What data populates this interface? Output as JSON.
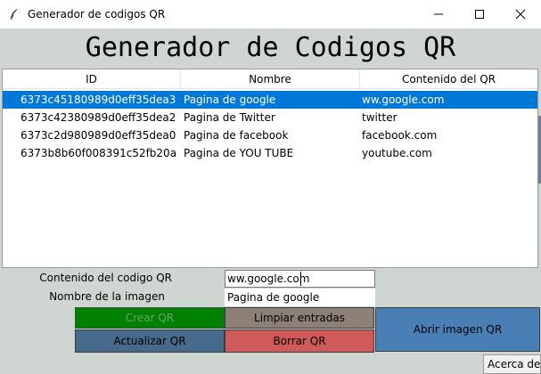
{
  "window": {
    "title": "Generador de codigos QR",
    "icon": "feather-icon",
    "controls": [
      "minimize-icon",
      "maximize-icon",
      "close-icon"
    ]
  },
  "heading": "Generador de Codigos QR",
  "table": {
    "columns": [
      "ID",
      "Nombre",
      "Contenido del QR"
    ],
    "rows": [
      {
        "id": "6373c45180989d0eff35dea3",
        "nombre": "Pagina de google",
        "contenido": "ww.google.com",
        "selected": true
      },
      {
        "id": "6373c42380989d0eff35dea2",
        "nombre": "Pagina de Twitter",
        "contenido": "twitter",
        "selected": false
      },
      {
        "id": "6373c2d980989d0eff35dea0",
        "nombre": "Pagina de facebook",
        "contenido": "facebook.com",
        "selected": false
      },
      {
        "id": "6373b8b60f008391c52fb20a",
        "nombre": "Pagina de YOU TUBE",
        "contenido": "youtube.com",
        "selected": false
      }
    ]
  },
  "form": {
    "contenido_label": "Contenido del codigo QR",
    "contenido_value": "ww.google.com",
    "nombre_label": "Nombre de la imagen",
    "nombre_value": "Pagina de google"
  },
  "buttons": {
    "crear": "Crear QR",
    "limpiar": "Limpiar entradas",
    "actualizar": "Actualizar QR",
    "borrar": "Borrar QR",
    "abrir": "Abrir imagen QR",
    "acerca": "Acerca de"
  },
  "colors": {
    "selection": "#0078d7",
    "crear": "#008000",
    "limpiar": "#8c8077",
    "actualizar": "#456a8c",
    "borrar": "#d05a5a",
    "abrir": "#4a7fb5",
    "background": "#cfd6d2"
  }
}
